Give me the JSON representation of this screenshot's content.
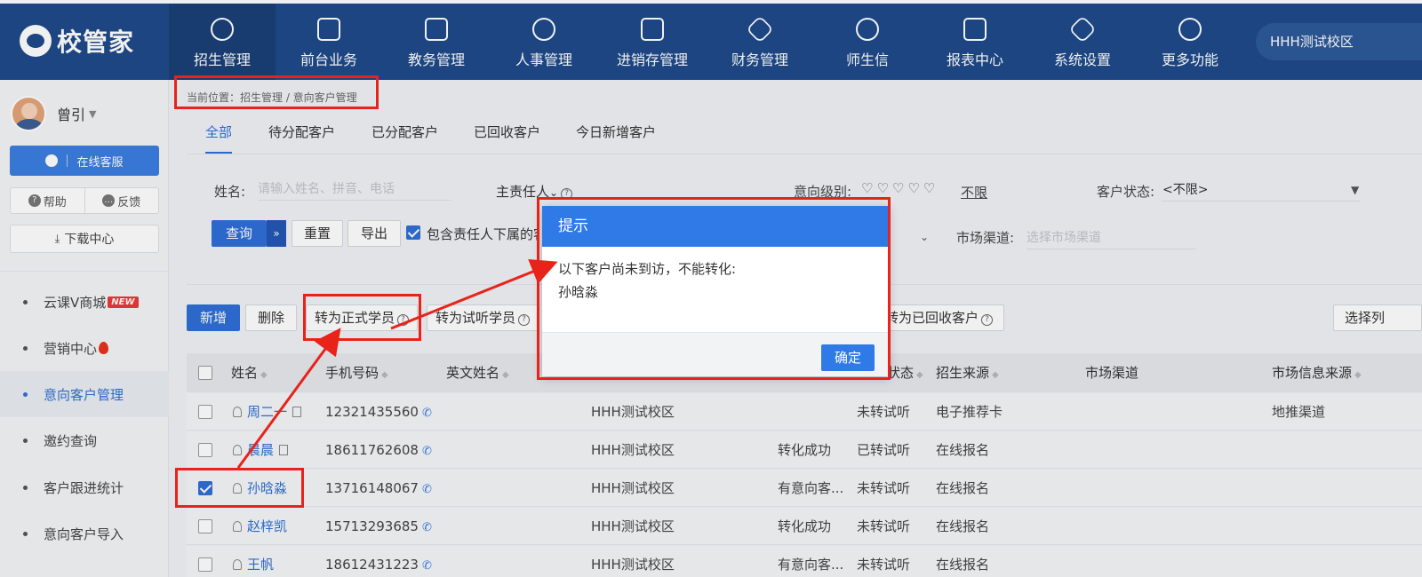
{
  "topnav": {
    "logo": "校管家",
    "items": [
      {
        "label": "招生管理",
        "icon": "person-add-icon"
      },
      {
        "label": "前台业务",
        "icon": "front-desk-icon"
      },
      {
        "label": "教务管理",
        "icon": "book-icon"
      },
      {
        "label": "人事管理",
        "icon": "person-icon"
      },
      {
        "label": "进销存管理",
        "icon": "inventory-icon"
      },
      {
        "label": "财务管理",
        "icon": "finance-icon"
      },
      {
        "label": "师生信",
        "icon": "chat-icon"
      },
      {
        "label": "报表中心",
        "icon": "report-icon"
      },
      {
        "label": "系统设置",
        "icon": "settings-icon"
      },
      {
        "label": "更多功能",
        "icon": "more-icon"
      }
    ],
    "campus": "HHH测试校区"
  },
  "sidebar": {
    "username": "曾引",
    "online_service": "在线客服",
    "help": "帮助",
    "feedback": "反馈",
    "download": "下载中心",
    "menu": [
      {
        "label": "云课V商城",
        "badge": "NEW"
      },
      {
        "label": "营销中心"
      },
      {
        "label": "意向客户管理"
      },
      {
        "label": "邀约查询"
      },
      {
        "label": "客户跟进统计"
      },
      {
        "label": "意向客户导入"
      }
    ]
  },
  "breadcrumb": "当前位置：招生管理 / 意向客户管理",
  "tabs": [
    "全部",
    "待分配客户",
    "已分配客户",
    "已回收客户",
    "今日新增客户"
  ],
  "filters": {
    "name_label": "姓名:",
    "name_placeholder": "请输入姓名、拼音、电话",
    "owner_label": "主责任人",
    "intent_label": "意向级别:",
    "intent_hearts": "♡♡♡♡♡",
    "intent_unlimited": "不限",
    "status_label": "客户状态:",
    "status_value": "<不限>",
    "channel_label": "市场渠道:",
    "channel_placeholder": "选择市场渠道"
  },
  "buttons": {
    "query": "查询",
    "reset": "重置",
    "export": "导出",
    "include_sub": "包含责任人下属的客",
    "add": "新增",
    "delete": "删除",
    "to_formal": "转为正式学员",
    "to_trial": "转为试听学员",
    "to_recycled": "转为已回收客户",
    "choose_columns": "选择列"
  },
  "table": {
    "headers": [
      "姓名",
      "手机号码",
      "英文姓名",
      "状态",
      "招生来源",
      "市场渠道",
      "市场信息来源"
    ],
    "rows": [
      {
        "name": "周二一",
        "phone": "12321435560",
        "campus": "HHH测试校区",
        "intent": "",
        "status": "未转试听",
        "source": "电子推荐卡",
        "info_source": "地推渠道",
        "checked": false
      },
      {
        "name": "晨晨",
        "phone": "18611762608",
        "campus": "HHH测试校区",
        "intent": "转化成功",
        "status": "已转试听",
        "source": "在线报名",
        "info_source": "",
        "checked": false
      },
      {
        "name": "孙晗淼",
        "phone": "13716148067",
        "campus": "HHH测试校区",
        "intent": "有意向客...",
        "status": "未转试听",
        "source": "在线报名",
        "info_source": "",
        "checked": true
      },
      {
        "name": "赵梓凯",
        "phone": "15713293685",
        "campus": "HHH测试校区",
        "intent": "转化成功",
        "status": "未转试听",
        "source": "在线报名",
        "info_source": "",
        "checked": false
      },
      {
        "name": "王帆",
        "phone": "18612431223",
        "campus": "HHH测试校区",
        "intent": "有意向客...",
        "status": "未转试听",
        "source": "在线报名",
        "info_source": "",
        "checked": false
      }
    ]
  },
  "dialog": {
    "title": "提示",
    "message_line1": "以下客户尚未到访，不能转化:",
    "message_line2": "孙晗淼",
    "ok": "确定"
  },
  "colors": {
    "nav_bg": "#1e4a8a",
    "primary": "#2f6fd6",
    "annotation": "#e8231a"
  }
}
